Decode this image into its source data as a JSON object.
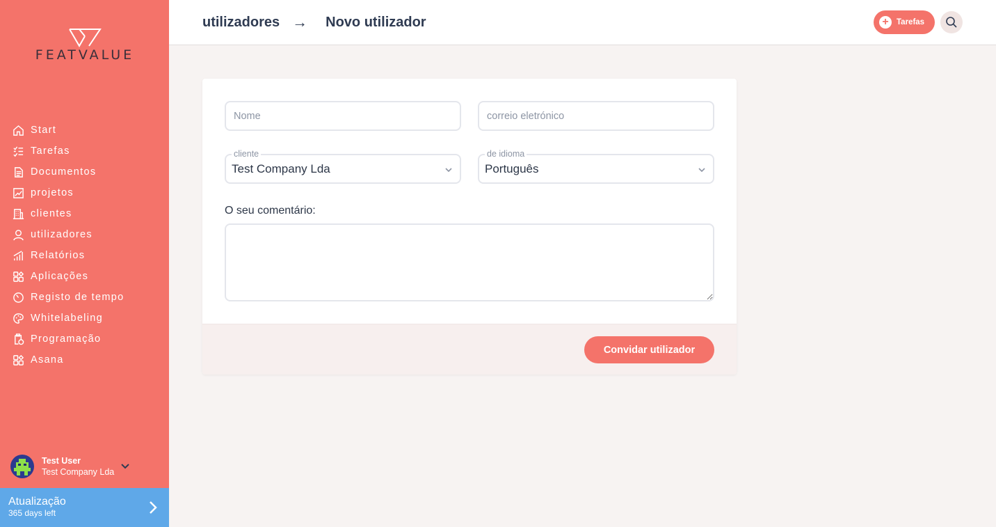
{
  "brand": {
    "name": "FEATVALUE"
  },
  "sidebar": {
    "items": [
      {
        "label": "Start",
        "icon": "home-icon"
      },
      {
        "label": "Tarefas",
        "icon": "task-list-icon"
      },
      {
        "label": "Documentos",
        "icon": "document-icon"
      },
      {
        "label": "projetos",
        "icon": "chart-icon"
      },
      {
        "label": "clientes",
        "icon": "building-icon"
      },
      {
        "label": "utilizadores",
        "icon": "user-icon"
      },
      {
        "label": "Relatórios",
        "icon": "bar-chart-icon"
      },
      {
        "label": "Aplicações",
        "icon": "apps-icon"
      },
      {
        "label": "Registo de tempo",
        "icon": "timer-icon"
      },
      {
        "label": "Whitelabeling",
        "icon": "palette-icon"
      },
      {
        "label": "Programação",
        "icon": "schedule-icon"
      },
      {
        "label": "Asana",
        "icon": "apps-icon"
      }
    ],
    "user": {
      "name": "Test User",
      "company": "Test Company Lda"
    },
    "upgrade": {
      "title": "Atualização",
      "subtitle": "365 days left"
    }
  },
  "header": {
    "breadcrumb_parent": "utilizadores",
    "breadcrumb_arrow": "→",
    "breadcrumb_current": "Novo utilizador",
    "tasks_button": "Tarefas"
  },
  "form": {
    "name_placeholder": "Nome",
    "email_placeholder": "correio eletrónico",
    "client_label": "cliente",
    "client_value": "Test Company Lda",
    "language_label": "de idioma",
    "language_value": "Português",
    "comment_label": "O seu comentário:",
    "submit_label": "Convidar utilizador"
  },
  "colors": {
    "accent": "#f4736a",
    "upgrade": "#5fa8e8",
    "text": "#2f3b52"
  }
}
